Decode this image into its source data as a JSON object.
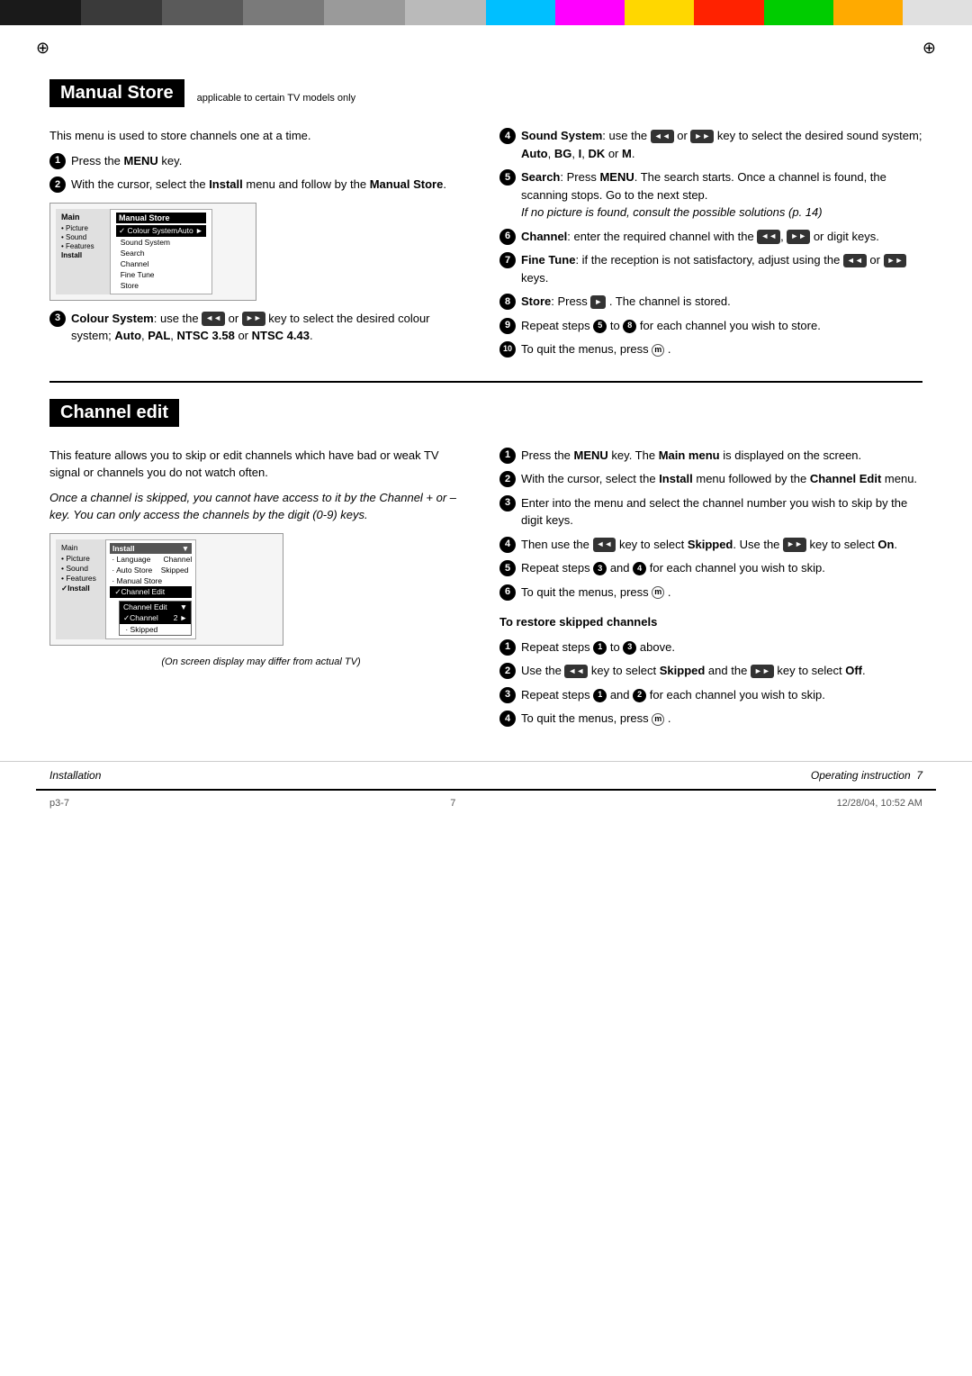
{
  "colors": {
    "black": "#000000",
    "white": "#ffffff",
    "cyan": "#00BFFF",
    "magenta": "#FF00FF",
    "yellow": "#FFD700",
    "red": "#FF0000",
    "green": "#00AA00",
    "blue": "#0000CC",
    "darkgray": "#333333",
    "gray": "#888888",
    "lightgray": "#E0E0E0"
  },
  "top_bar": {
    "left_blocks": [
      "#1a1a1a",
      "#3a3a3a",
      "#5a5a5a",
      "#7a7a7a",
      "#9a9a9a",
      "#bababa"
    ],
    "right_blocks": [
      "#00BFFF",
      "#FF00FF",
      "#FFD700",
      "#FF2200",
      "#00CC00",
      "#FFAA00",
      "#E0E0E0"
    ]
  },
  "manual_store": {
    "title": "Manual Store",
    "subtitle": "applicable to certain TV models only",
    "intro": "This menu is used to store channels one at a time.",
    "steps": [
      {
        "num": "1",
        "text": "Press the ",
        "bold": "MENU",
        "after": " key."
      },
      {
        "num": "2",
        "text": "With the cursor, select the ",
        "bold": "Install",
        "after": " menu and follow by the ",
        "bold2": "Manual Store",
        "end": "."
      },
      {
        "num": "3",
        "text": "Colour System",
        "detail": ": use the",
        "after_detail": " or",
        "rest": " key to select the desired colour system; ",
        "bold_items": "Auto, PAL, NTSC 3.58",
        "or_text": " or ",
        "last_bold": "NTSC 4.43",
        "period": "."
      }
    ],
    "right_steps": [
      {
        "num": "4",
        "label": "Sound System",
        "text": ": use the",
        "rest": " or",
        "after": " key to select the desired sound system; ",
        "bold": "Auto, BG, I, DK",
        "or": " or ",
        "last": "M."
      },
      {
        "num": "5",
        "label": "Search",
        "text": ": Press ",
        "bold": "MENU",
        "rest": ". The search starts. Once a channel is found, the scanning stops. Go to the next step.",
        "italic": "If no picture is found, consult the possible solutions (p. 14)"
      },
      {
        "num": "6",
        "label": "Channel",
        "text": ": enter the required channel with the",
        "rest": ",",
        "after": " or digit keys."
      },
      {
        "num": "7",
        "label": "Fine Tune",
        "text": ": if the reception is not satisfactory, adjust using the",
        "rest": " or",
        "after": " keys."
      },
      {
        "num": "8",
        "label": "Store",
        "text": ": Press",
        "rest": ". The channel is stored."
      },
      {
        "num": "9",
        "text": "Repeat steps",
        "bold5": "5",
        "to": " to",
        "bold8": "8",
        "rest": " for each channel you wish to store."
      },
      {
        "num": "10",
        "text": "To quit the menus, press"
      }
    ],
    "menu_screenshot": {
      "sidebar_title": "Main",
      "sidebar_items": [
        "• Picture",
        "• Sound",
        "• Features",
        "Install"
      ],
      "menu_title": "Manual Store",
      "menu_items": [
        {
          "label": "✓ Colour System",
          "value": "Auto",
          "arrow": "►",
          "selected": true
        },
        {
          "label": "  Sound System",
          "value": ""
        },
        {
          "label": "  Search",
          "value": ""
        },
        {
          "label": "  Channel",
          "value": ""
        },
        {
          "label": "  Fine Tune",
          "value": ""
        },
        {
          "label": "  Store",
          "value": ""
        }
      ]
    }
  },
  "channel_edit": {
    "title": "Channel edit",
    "intro": "This feature allows you to skip or edit channels which have bad or weak TV signal or channels you do not watch often.",
    "italic_note": "Once a channel is skipped, you cannot have access to it by the Channel + or – key. You can only access the channels by the digit (0-9) keys.",
    "steps": [
      {
        "num": "1",
        "text": "Press the ",
        "bold": "MENU",
        "after": " key. The ",
        "bold2": "Main menu",
        "rest": " is displayed on the screen."
      },
      {
        "num": "2",
        "text": "With the cursor, select the ",
        "bold": "Install",
        "after": " menu followed by the ",
        "bold2": "Channel Edit",
        "rest": " menu."
      },
      {
        "num": "3",
        "text": "Enter into the menu and select the channel number you wish to skip by the digit keys."
      },
      {
        "num": "4",
        "text": "Then use the",
        "icon": "left-arrow",
        "bold": " key to select ",
        "boldval": "Skipped",
        "rest": ". Use the",
        "icon2": "right-arrow",
        "last": " key to select ",
        "lastval": "On."
      },
      {
        "num": "5",
        "text": "Repeat steps",
        "bold3": "3",
        "and": " and",
        "bold4": "4",
        "rest": " for each channel you wish to skip."
      },
      {
        "num": "6",
        "text": "To quit the menus, press"
      }
    ],
    "restore_title": "To restore skipped channels",
    "restore_steps": [
      {
        "num": "1",
        "text": "Repeat steps",
        "bold1": "1",
        "to": " to",
        "bold3": "3",
        "rest": " above."
      },
      {
        "num": "2",
        "text": "Use the",
        "icon": "left-arrow",
        "rest": " key to select ",
        "bold": "Skipped",
        "and": " and the",
        "icon2": "right-arrow",
        "last": " key to select ",
        "lastval": "Off."
      },
      {
        "num": "3",
        "text": "Repeat steps",
        "bold1": "1",
        "and": " and",
        "bold2": "2",
        "rest": " for each channel you wish to skip."
      },
      {
        "num": "4",
        "text": "To quit the menus, press"
      }
    ],
    "caption": "(On screen display may differ from actual TV)",
    "menu_screenshot": {
      "sidebar_items": [
        "Main",
        "• Picture",
        "• Sound",
        "• Features",
        "✓Install"
      ],
      "main_items": [
        {
          "label": "Install",
          "arrow": "▼"
        },
        {
          "label": "  · Language",
          "value": "Channel"
        },
        {
          "label": "  · Auto Store",
          "value": "Skipped"
        },
        {
          "label": "  · Manual Store",
          "value": ""
        },
        {
          "label": "  ✓Channel Edit",
          "value": ""
        }
      ],
      "sub_title": "Channel Edit",
      "sub_items": [
        {
          "label": "✓Channel",
          "value": "2",
          "arrow": "►",
          "selected": true
        },
        {
          "label": "  · Skipped",
          "value": ""
        }
      ]
    }
  },
  "footer": {
    "left": "Installation",
    "right": "Operating instruction",
    "page": "7"
  },
  "bottom": {
    "left": "p3-7",
    "center": "7",
    "right": "12/28/04, 10:52 AM"
  }
}
